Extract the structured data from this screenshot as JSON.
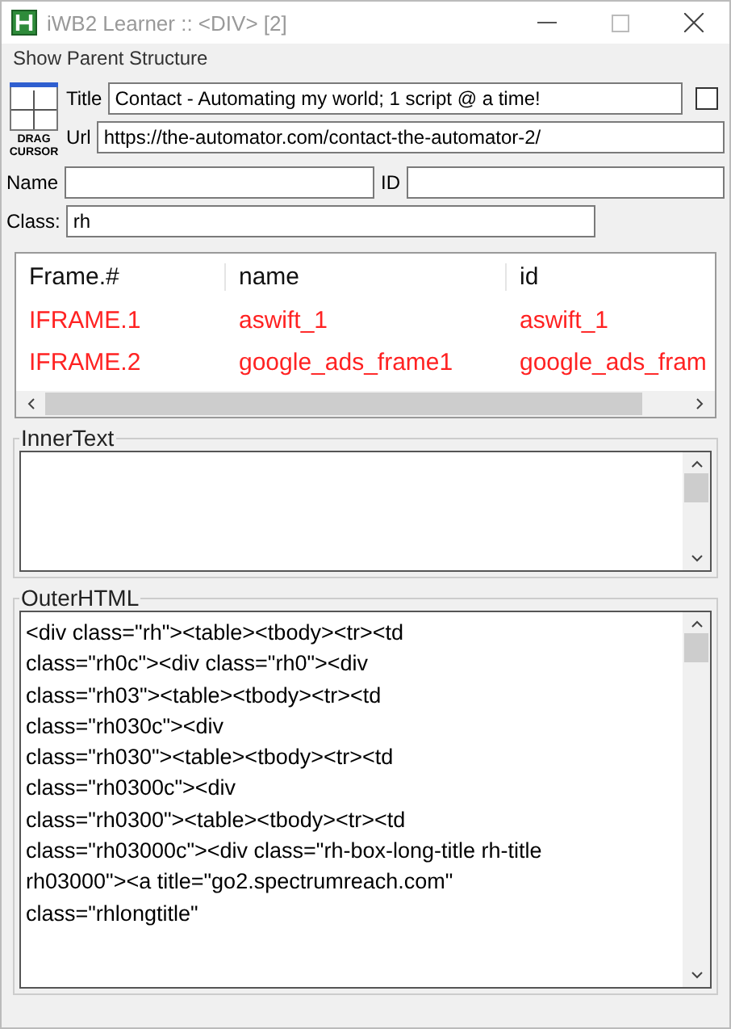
{
  "window": {
    "title": "iWB2 Learner :: <DIV> [2]"
  },
  "menu": [
    "Show Parent Structure"
  ],
  "drag_cursor": {
    "label": "DRAG CURSOR"
  },
  "title_field": {
    "label": "Title",
    "value": "Contact - Automating my world; 1 script @ a time!"
  },
  "checkbox": {
    "checked": false
  },
  "url_field": {
    "label": "Url",
    "value": "https://the-automator.com/contact-the-automator-2/"
  },
  "name_field": {
    "label": "Name"
  },
  "id_field": {
    "label": "ID"
  },
  "class_field": {
    "label": "Class:",
    "value": "rh"
  },
  "frames_table": {
    "columns": [
      "Frame.#",
      "name",
      "id"
    ],
    "rows": [
      [
        "IFRAME.1",
        "aswift_1",
        "aswift_1"
      ],
      [
        "IFRAME.2",
        "google_ads_frame1",
        "google_ads_fram"
      ]
    ]
  },
  "inner_text": {
    "label": "InnerText"
  },
  "outer_html": {
    "label": "OuterHTML",
    "lines": [
      "<div class=\"rh\"><table><tbody><tr><td",
      "class=\"rh0c\"><div class=\"rh0\"><div",
      "class=\"rh03\"><table><tbody><tr><td",
      "class=\"rh030c\"><div",
      "class=\"rh030\"><table><tbody><tr><td",
      "class=\"rh0300c\"><div",
      "class=\"rh0300\"><table><tbody><tr><td",
      "class=\"rh03000c\"><div class=\"rh-box-long-title rh-title",
      "rh03000\"><a title=\"go2.spectrumreach.com\"",
      "class=\"rhlongtitle\""
    ]
  }
}
